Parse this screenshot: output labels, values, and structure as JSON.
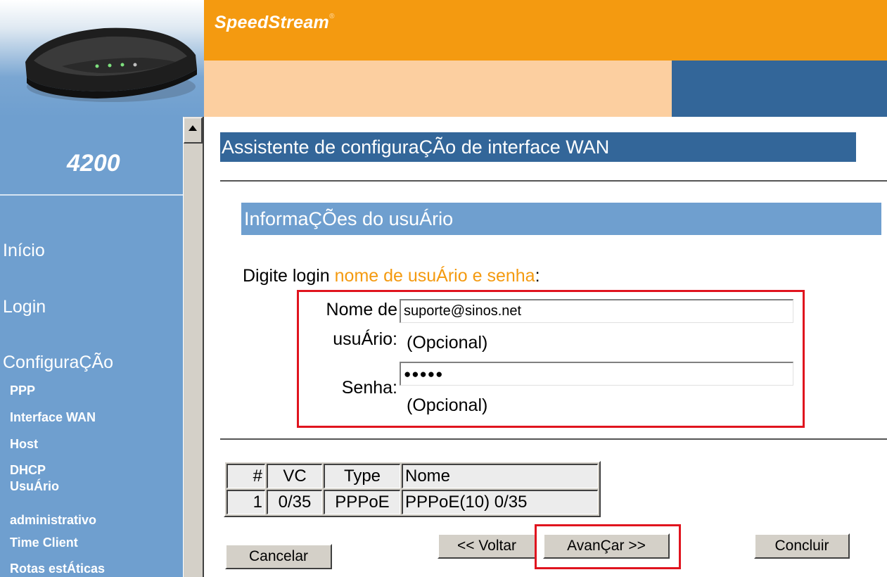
{
  "header": {
    "brand": "SpeedStream",
    "brand_mark": "®",
    "model": "4200"
  },
  "sidebar": {
    "main_items": [
      {
        "label": "Início"
      },
      {
        "label": "Login"
      },
      {
        "label": "ConfiguraÇÃo"
      }
    ],
    "sub_items": [
      {
        "label": "PPP"
      },
      {
        "label": "Interface WAN"
      },
      {
        "label": "Host"
      },
      {
        "label": "DHCP"
      },
      {
        "label": "UsuÁrio"
      },
      {
        "label": "administrativo"
      },
      {
        "label": "Time Client"
      },
      {
        "label": "Rotas estÁticas"
      }
    ]
  },
  "main": {
    "title": "Assistente de configuraÇÃo de interface WAN",
    "section_title": "InformaÇÕes do usuÁrio",
    "prompt_prefix": "Digite login ",
    "prompt_highlight": "nome de usuÁrio e senha",
    "prompt_suffix": ":",
    "username": {
      "label_line1": "Nome de",
      "label_line2": "usuÁrio:",
      "value": "suporte@sinos.net",
      "hint": "(Opcional)"
    },
    "password": {
      "label": "Senha:",
      "value": "●●●●●",
      "hint": "(Opcional)"
    },
    "table": {
      "headers": [
        "#",
        "VC",
        "Type",
        "Nome"
      ],
      "rows": [
        [
          "1",
          "0/35",
          "PPPoE",
          "PPPoE(10) 0/35"
        ]
      ]
    },
    "buttons": {
      "cancel": "Cancelar",
      "back": "<< Voltar",
      "next": "AvanÇar >>",
      "finish": "Concluir"
    }
  },
  "colors": {
    "header_orange": "#f49a10",
    "header_peach": "#fccfa0",
    "header_blue": "#336699",
    "sidebar_blue": "#6f9fcf",
    "highlight_red": "#e0141e"
  }
}
